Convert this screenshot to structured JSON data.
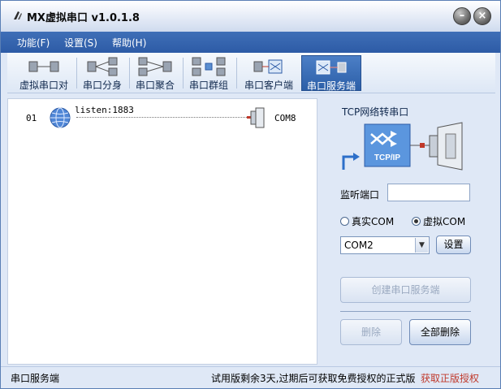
{
  "window": {
    "title": "MX虚拟串口  v1.0.1.8"
  },
  "menu": [
    "功能(F)",
    "设置(S)",
    "帮助(H)"
  ],
  "toolbar": [
    {
      "label": "虚拟串口对",
      "icon": "serial-pair-icon"
    },
    {
      "label": "串口分身",
      "icon": "serial-split-icon"
    },
    {
      "label": "串口聚合",
      "icon": "serial-merge-icon"
    },
    {
      "label": "串口群组",
      "icon": "serial-group-icon"
    },
    {
      "label": "串口客户端",
      "icon": "serial-client-icon"
    },
    {
      "label": "串口服务端",
      "icon": "serial-server-icon",
      "active": true
    }
  ],
  "list": {
    "rows": [
      {
        "num": "01",
        "listen": "listen:1883",
        "com": "COM8"
      }
    ]
  },
  "panel": {
    "title": "TCP网络转串口",
    "diagram_label": "TCP/IP",
    "port_label": "监听端口",
    "port_value": "",
    "radio_real": "真实COM",
    "radio_virtual": "虚拟COM",
    "selected_radio": "virtual",
    "com_select": "COM2",
    "settings_button": "设置",
    "create_button": "创建串口服务端",
    "delete_button": "删除",
    "delete_all_button": "全部删除"
  },
  "status": {
    "left": "串口服务端",
    "message": "试用版剩余3天,过期后可获取免费授权的正式版",
    "link": "获取正版授权"
  },
  "colors": {
    "accent": "#2d5ba6",
    "link": "#c0392b",
    "panel_bg": "#dfe8f6"
  }
}
